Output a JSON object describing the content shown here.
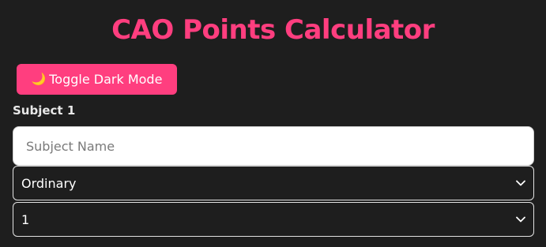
{
  "page": {
    "title": "CAO Points Calculator"
  },
  "toolbar": {
    "dark_mode_icon": "moon-icon",
    "dark_mode_icon_glyph": "🌙",
    "dark_mode_label": "Toggle Dark Mode"
  },
  "subject": {
    "label": "Subject 1",
    "name_placeholder": "Subject Name",
    "name_value": "",
    "level_value": "Ordinary",
    "grade_value": "1"
  },
  "colors": {
    "accent": "#ff3e7f",
    "background": "#1e1e1e",
    "text": "#ffffff"
  }
}
